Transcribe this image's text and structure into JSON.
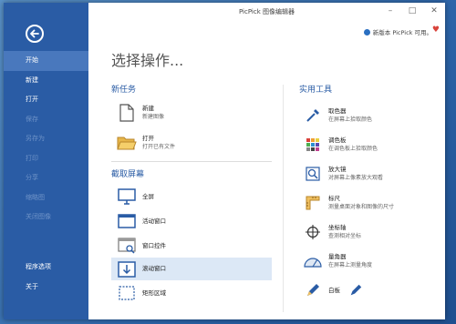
{
  "window": {
    "title": "PicPick 图像编辑器",
    "update_notice": "新版本 PicPick 可用。",
    "minimize": "–",
    "maximize": "□",
    "close": "✕"
  },
  "sidebar": {
    "items": [
      {
        "label": "开始",
        "state": "active"
      },
      {
        "label": "新建",
        "state": "enabled"
      },
      {
        "label": "打开",
        "state": "enabled"
      },
      {
        "label": "保存",
        "state": "disabled"
      },
      {
        "label": "另存为",
        "state": "disabled"
      },
      {
        "label": "打印",
        "state": "disabled"
      },
      {
        "label": "分享",
        "state": "disabled"
      },
      {
        "label": "缩略图",
        "state": "disabled"
      },
      {
        "label": "关闭图像",
        "state": "disabled"
      }
    ],
    "bottom": [
      {
        "label": "程序选项"
      },
      {
        "label": "关于"
      }
    ]
  },
  "main": {
    "heading": "选择操作...",
    "new_task": {
      "title": "新任务",
      "items": [
        {
          "label": "新建",
          "desc": "新建图像",
          "icon": "document-icon"
        },
        {
          "label": "打开",
          "desc": "打开已有文件",
          "icon": "folder-icon"
        }
      ]
    },
    "capture": {
      "title": "截取屏幕",
      "items": [
        {
          "label": "全屏",
          "icon": "monitor-icon"
        },
        {
          "label": "活动窗口",
          "icon": "window-icon"
        },
        {
          "label": "窗口控件",
          "icon": "window-control-icon"
        },
        {
          "label": "滚动窗口",
          "icon": "scroll-window-icon"
        },
        {
          "label": "矩形区域",
          "icon": "rectangle-region-icon"
        }
      ]
    },
    "tools": {
      "title": "实用工具",
      "items": [
        {
          "label": "取色器",
          "desc": "在屏幕上拾取颜色",
          "icon": "eyedropper-icon"
        },
        {
          "label": "调色板",
          "desc": "在调色板上拾取颜色",
          "icon": "palette-icon"
        },
        {
          "label": "放大镜",
          "desc": "对屏幕上像素放大观看",
          "icon": "magnifier-icon"
        },
        {
          "label": "标尺",
          "desc": "测量桌面对象和图像的尺寸",
          "icon": "ruler-icon"
        },
        {
          "label": "坐标轴",
          "desc": "查测相对坐标",
          "icon": "crosshair-icon"
        },
        {
          "label": "量角器",
          "desc": "在屏幕上测量角度",
          "icon": "protractor-icon"
        },
        {
          "label": "白板",
          "desc": "",
          "icon": "pen-icon"
        }
      ]
    }
  },
  "colors": {
    "sidebar": "#2a5ca5",
    "accent": "#2a5ca5",
    "heart": "#d9433b"
  }
}
